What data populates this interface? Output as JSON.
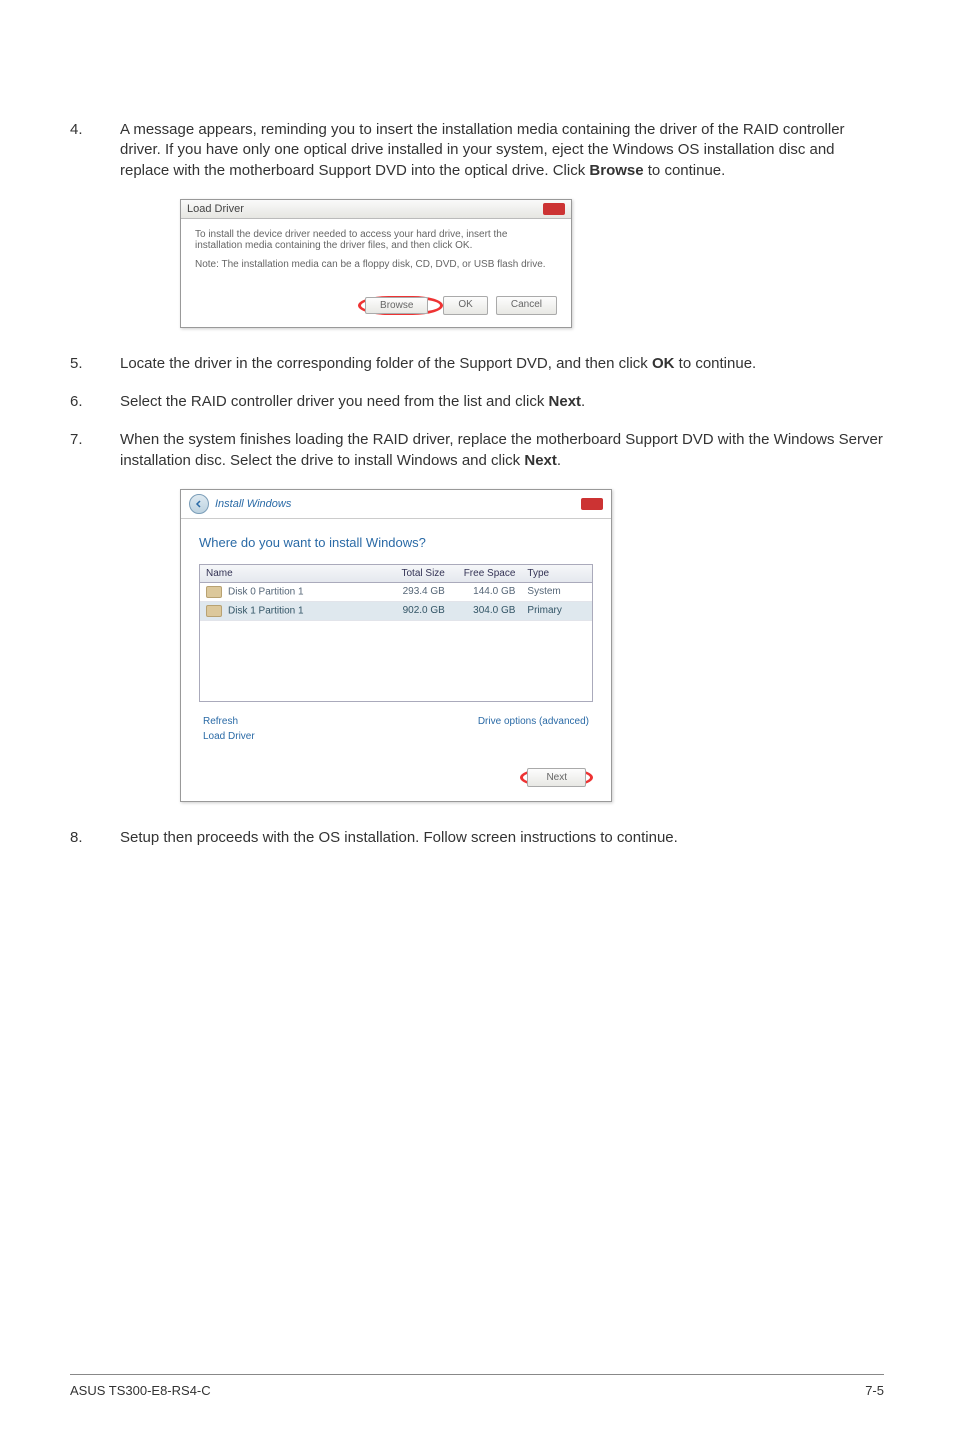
{
  "steps": {
    "s4": {
      "num": "4.",
      "text_a": "A message appears, reminding you to insert the installation media containing the driver of the RAID controller driver. If you have only one optical drive installed in your system, eject the Windows OS installation disc and replace with the motherboard Support DVD into the optical drive. Click ",
      "text_bold": "Browse",
      "text_b": " to continue."
    },
    "s5": {
      "num": "5.",
      "text_a": "Locate the driver in the corresponding folder of the Support DVD, and then click ",
      "text_bold": "OK",
      "text_b": " to continue."
    },
    "s6": {
      "num": "6.",
      "text_a": "Select the RAID controller driver you need from the list and click ",
      "text_bold": "Next",
      "text_b": "."
    },
    "s7": {
      "num": "7.",
      "text_a": "When the system finishes loading the RAID driver, replace the motherboard Support DVD with the Windows Server installation disc. Select the drive to install Windows and click ",
      "text_bold": "Next",
      "text_b": "."
    },
    "s8": {
      "num": "8.",
      "text_a": "Setup then proceeds with the OS installation. Follow screen instructions to continue."
    }
  },
  "load_driver": {
    "title": "Load Driver",
    "msg1": "To install the device driver needed to access your hard drive, insert the installation media containing the driver files, and then click OK.",
    "msg2": "Note: The installation media can be a floppy disk, CD, DVD, or USB flash drive.",
    "btn_browse": "Browse",
    "btn_ok": "OK",
    "btn_cancel": "Cancel"
  },
  "install_win": {
    "title": "Install Windows",
    "question": "Where do you want to install Windows?",
    "hdr_name": "Name",
    "hdr_total": "Total Size",
    "hdr_free": "Free Space",
    "hdr_type": "Type",
    "rows": [
      {
        "name": "Disk 0 Partition 1",
        "total": "293.4 GB",
        "free": "144.0 GB",
        "type": "System"
      },
      {
        "name": "Disk 1 Partition 1",
        "total": "902.0 GB",
        "free": "304.0 GB",
        "type": "Primary"
      }
    ],
    "link_refresh": "Refresh",
    "link_load": "Load Driver",
    "link_drive": "Drive options (advanced)",
    "btn_next": "Next"
  },
  "footer": {
    "left": "ASUS TS300-E8-RS4-C",
    "right": "7-5"
  }
}
